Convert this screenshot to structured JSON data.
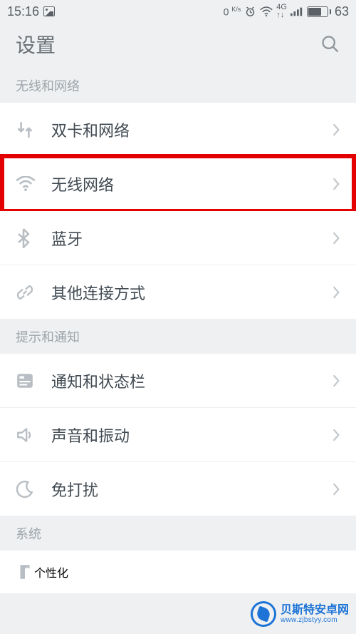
{
  "status": {
    "time": "15:16",
    "speed": "0",
    "speed_unit": "K/s",
    "battery": "63"
  },
  "header": {
    "title": "设置"
  },
  "sections": {
    "wireless": {
      "title": "无线和网络",
      "items": [
        {
          "label": "双卡和网络"
        },
        {
          "label": "无线网络"
        },
        {
          "label": "蓝牙"
        },
        {
          "label": "其他连接方式"
        }
      ]
    },
    "notify": {
      "title": "提示和通知",
      "items": [
        {
          "label": "通知和状态栏"
        },
        {
          "label": "声音和振动"
        },
        {
          "label": "免打扰"
        }
      ]
    },
    "system": {
      "title": "系统",
      "items": [
        {
          "label": "个性化"
        }
      ]
    }
  },
  "watermark": {
    "main": "贝斯特安卓网",
    "sub": "www.zjbstyy.com"
  }
}
